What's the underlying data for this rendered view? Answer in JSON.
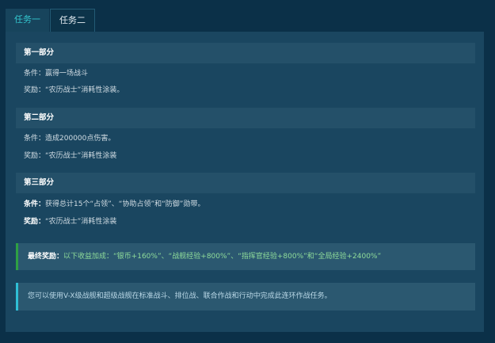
{
  "tabs": [
    {
      "label": "任务一",
      "active": true
    },
    {
      "label": "任务二",
      "active": false
    }
  ],
  "sections": [
    {
      "title": "第一部分",
      "condition_label": "条件：",
      "condition": "赢得一场战斗",
      "reward_label": "奖励：",
      "reward": "“农历战士”消耗性涂装。"
    },
    {
      "title": "第二部分",
      "condition_label": "条件：",
      "condition": "造成200000点伤害。",
      "reward_label": "奖励：",
      "reward": "“农历战士”消耗性涂装"
    },
    {
      "title": "第三部分",
      "condition_label": "条件：",
      "condition": "获得总计15个“占领”、“协助占领”和“防御”勋带。",
      "reward_label": "奖励：",
      "reward": "“农历战士”消耗性涂装"
    }
  ],
  "final_reward": {
    "label": "最终奖励：",
    "text": "以下收益加成：“银币+160%”、“战舰经验+800%”、“指挥官经验+800%”和“全局经验+2400%”"
  },
  "info_note": "您可以使用V-X级战舰和超级战舰在标准战斗、排位战、联合作战和行动中完成此连环作战任务。",
  "colors": {
    "background": "#0b3048",
    "panel": "#1a4660",
    "active_tab_text": "#33c6ce",
    "final_accent": "#2ea043",
    "info_accent": "#2fbfd6"
  }
}
